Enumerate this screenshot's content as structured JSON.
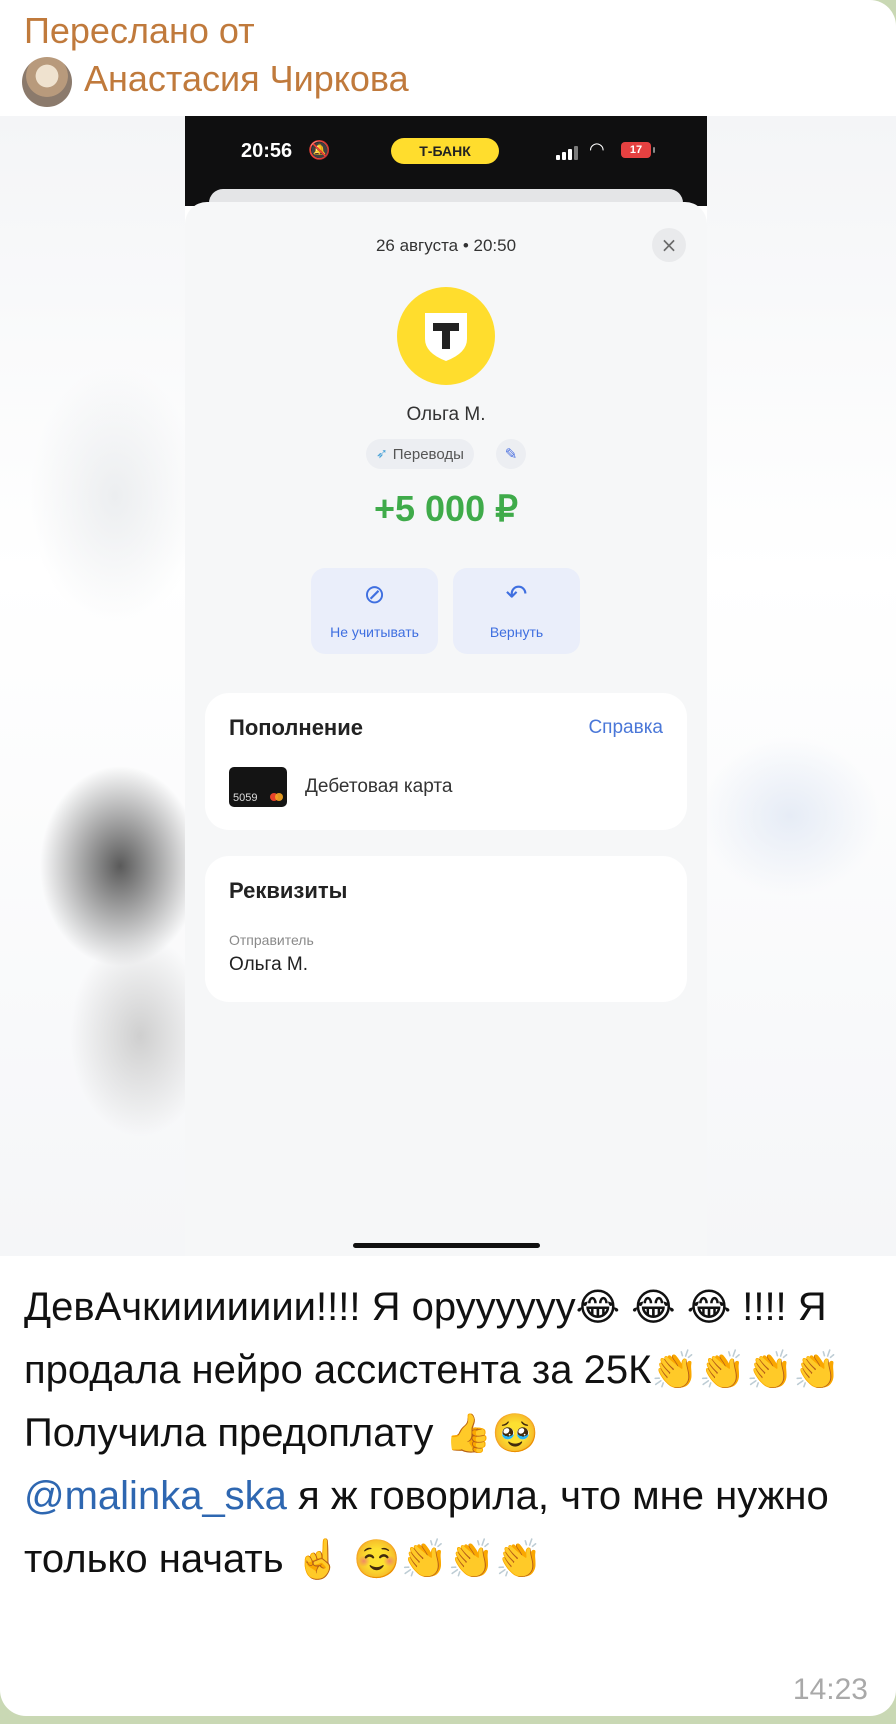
{
  "forward": {
    "label": "Переслано от",
    "sender": "Анастасия Чиркова"
  },
  "screenshot": {
    "status_bar": {
      "time": "20:56",
      "bank_badge": "Т-БАНК",
      "battery": "17"
    },
    "date": "26 августа • 20:50",
    "close_icon": "×",
    "logo_letter": "T",
    "sender_name": "Ольга М.",
    "category": "Переводы",
    "amount": "+5 000 ₽",
    "actions": [
      {
        "label": "Не учитывать",
        "icon": "eye-off-icon"
      },
      {
        "label": "Вернуть",
        "icon": "return-arrow-icon"
      }
    ],
    "topup_card": {
      "title": "Пополнение",
      "help_link": "Справка",
      "card_number": "5059",
      "card_name": "Дебетовая карта"
    },
    "details_card": {
      "title": "Реквизиты",
      "field_label": "Отправитель",
      "field_value": "Ольга М."
    }
  },
  "message": {
    "p1": "ДевАчкиииииии!!!! Я оруууууу",
    "e_laugh": "😂",
    "p2": "!!!! Я продала нейро ассистента за 25К",
    "e_clap": "👏",
    "p3": "Получила предоплату ",
    "e_thumbs": "👍",
    "e_pleading": "🥹",
    "mention": "@malinka_ska",
    "p4": "  я ж говорила, что мне нужно только начать ",
    "e_point": "☝️",
    "e_smile": "☺️",
    "time": "14:23"
  },
  "colors": {
    "forward_accent": "#c07a3c",
    "amount_green": "#3fab4a",
    "link_blue": "#2e67b1",
    "tbank_yellow": "#ffdd2d"
  }
}
